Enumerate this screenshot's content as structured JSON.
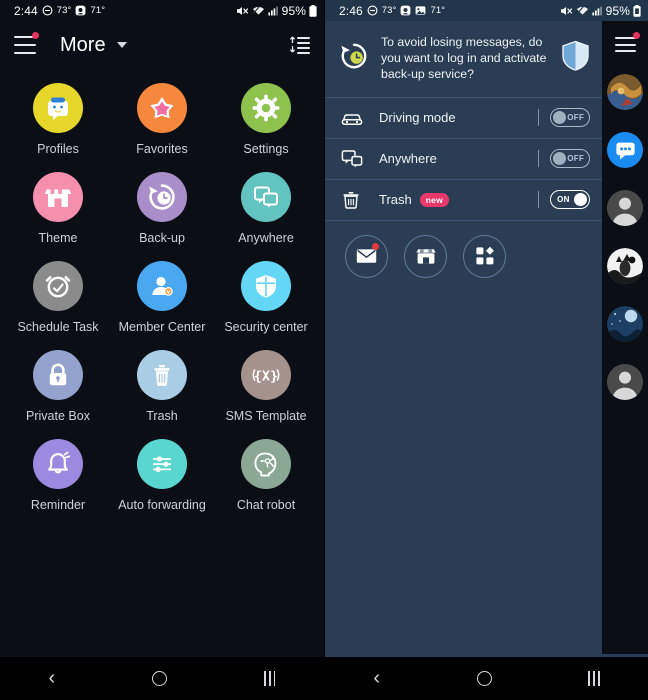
{
  "left_phone": {
    "status_bar": {
      "time": "2:44",
      "dnd_icon": "do-not-disturb-icon",
      "temp_1": "73°",
      "weather_icon": "weather-icon",
      "temp_2": "71°",
      "mute_icon": "mute-icon",
      "wifi_icon": "wifi-icon",
      "signal_icon": "signal-icon",
      "battery_text": "95%",
      "battery_icon": "battery-icon"
    },
    "app_bar": {
      "menu_icon": "hamburger-menu-icon",
      "menu_badge": true,
      "title": "More",
      "dropdown_icon": "caret-down-icon",
      "sort_icon": "sort-list-icon"
    },
    "grid_items": [
      {
        "label": "Profiles",
        "icon": "profiles-icon",
        "circle_color": "#e8d72b",
        "fg": "#ffffff"
      },
      {
        "label": "Favorites",
        "icon": "star-icon",
        "circle_color": "#f5883d",
        "fg": "#ffffff"
      },
      {
        "label": "Settings",
        "icon": "gear-icon",
        "circle_color": "#8dc24f",
        "fg": "#ffffff"
      },
      {
        "label": "Theme",
        "icon": "storefront-icon",
        "circle_color": "#f58fae",
        "fg": "#ffffff"
      },
      {
        "label": "Back-up",
        "icon": "backup-clock-icon",
        "circle_color": "#a98fc9",
        "fg": "#ffffff"
      },
      {
        "label": "Anywhere",
        "icon": "anywhere-screens-icon",
        "circle_color": "#63c3c0",
        "fg": "#ffffff"
      },
      {
        "label": "Schedule Task",
        "icon": "alarm-clock-icon",
        "circle_color": "#8b8b8b",
        "fg": "#ffffff"
      },
      {
        "label": "Member Center",
        "icon": "member-person-icon",
        "circle_color": "#4aa8f0",
        "fg": "#ffffff"
      },
      {
        "label": "Security center",
        "icon": "shield-icon",
        "circle_color": "#63d7f5",
        "fg": "#ffffff"
      },
      {
        "label": "Private Box",
        "icon": "lock-icon",
        "circle_color": "#93a3cd",
        "fg": "#ffffff"
      },
      {
        "label": "Trash",
        "icon": "trash-icon",
        "circle_color": "#a9cde4",
        "fg": "#ffffff"
      },
      {
        "label": "SMS Template",
        "icon": "sms-template-icon",
        "circle_color": "#a4938c",
        "fg": "#ffffff"
      },
      {
        "label": "Reminder",
        "icon": "bell-icon",
        "circle_color": "#9b8ae0",
        "fg": "#ffffff"
      },
      {
        "label": "Auto forwarding",
        "icon": "sliders-icon",
        "circle_color": "#5ad6d0",
        "fg": "#ffffff"
      },
      {
        "label": "Chat robot",
        "icon": "chat-robot-head-icon",
        "circle_color": "#8aa894",
        "fg": "#ffffff"
      }
    ],
    "nav_bar": {
      "back_icon": "back-icon",
      "home_icon": "home-icon",
      "recents_icon": "recents-icon"
    }
  },
  "right_phone": {
    "status_bar": {
      "time": "2:46",
      "dnd_icon": "do-not-disturb-icon",
      "temp_1": "73°",
      "weather_icon": "weather-icon",
      "gallery_icon": "gallery-icon",
      "temp_2": "71°",
      "mute_icon": "mute-icon",
      "wifi_icon": "wifi-icon",
      "signal_icon": "signal-icon",
      "battery_text": "95%",
      "battery_icon": "battery-icon"
    },
    "banner": {
      "icon": "backup-restore-clock-icon",
      "message": "To avoid losing messages, do you want to log in and activate back-up service?",
      "trailing_icon": "shield-icon"
    },
    "settings_rows": [
      {
        "label": "Driving mode",
        "icon": "car-icon",
        "toggle_state": "OFF",
        "badge": null
      },
      {
        "label": "Anywhere",
        "icon": "anywhere-icon",
        "toggle_state": "OFF",
        "badge": null
      },
      {
        "label": "Trash",
        "icon": "trash-icon",
        "toggle_state": "ON",
        "badge": "new"
      }
    ],
    "action_buttons": [
      {
        "icon": "envelope-icon",
        "name": "messages-action",
        "has_badge": true
      },
      {
        "icon": "store-icon",
        "name": "store-action",
        "has_badge": false
      },
      {
        "icon": "apps-grid-icon",
        "name": "apps-action",
        "has_badge": false
      }
    ],
    "rail": {
      "menu_icon": "hamburger-menu-icon",
      "menu_badge": true,
      "avatars": [
        {
          "name": "avatar-artwork",
          "type": "image",
          "colors": [
            "#8a5a2b",
            "#c9903f",
            "#3a5d8f"
          ]
        },
        {
          "name": "avatar-messages",
          "type": "chat",
          "colors": [
            "#1a8cf0"
          ]
        },
        {
          "name": "avatar-contact-1",
          "type": "person",
          "colors": [
            "#4a4a4a"
          ]
        },
        {
          "name": "avatar-catwoman",
          "type": "image",
          "colors": [
            "#ffffff",
            "#1a1a1a"
          ]
        },
        {
          "name": "avatar-night",
          "type": "image",
          "colors": [
            "#1d3f63",
            "#78a8cc"
          ]
        },
        {
          "name": "avatar-contact-2",
          "type": "person",
          "colors": [
            "#4a4a4a"
          ]
        }
      ]
    },
    "nav_bar": {
      "back_icon": "back-icon",
      "home_icon": "home-icon",
      "recents_icon": "recents-icon"
    }
  },
  "theme": {
    "left_bg": "#0b0e15",
    "right_panel_bg": "#2a3d54",
    "right_statusbar_bg": "#22364b",
    "rail_bg": "#0b0e15",
    "accent_badge": "#e0335f",
    "new_badge": "#e8376a",
    "nav_bg": "#000000",
    "label_color": "#cfd2d8"
  }
}
